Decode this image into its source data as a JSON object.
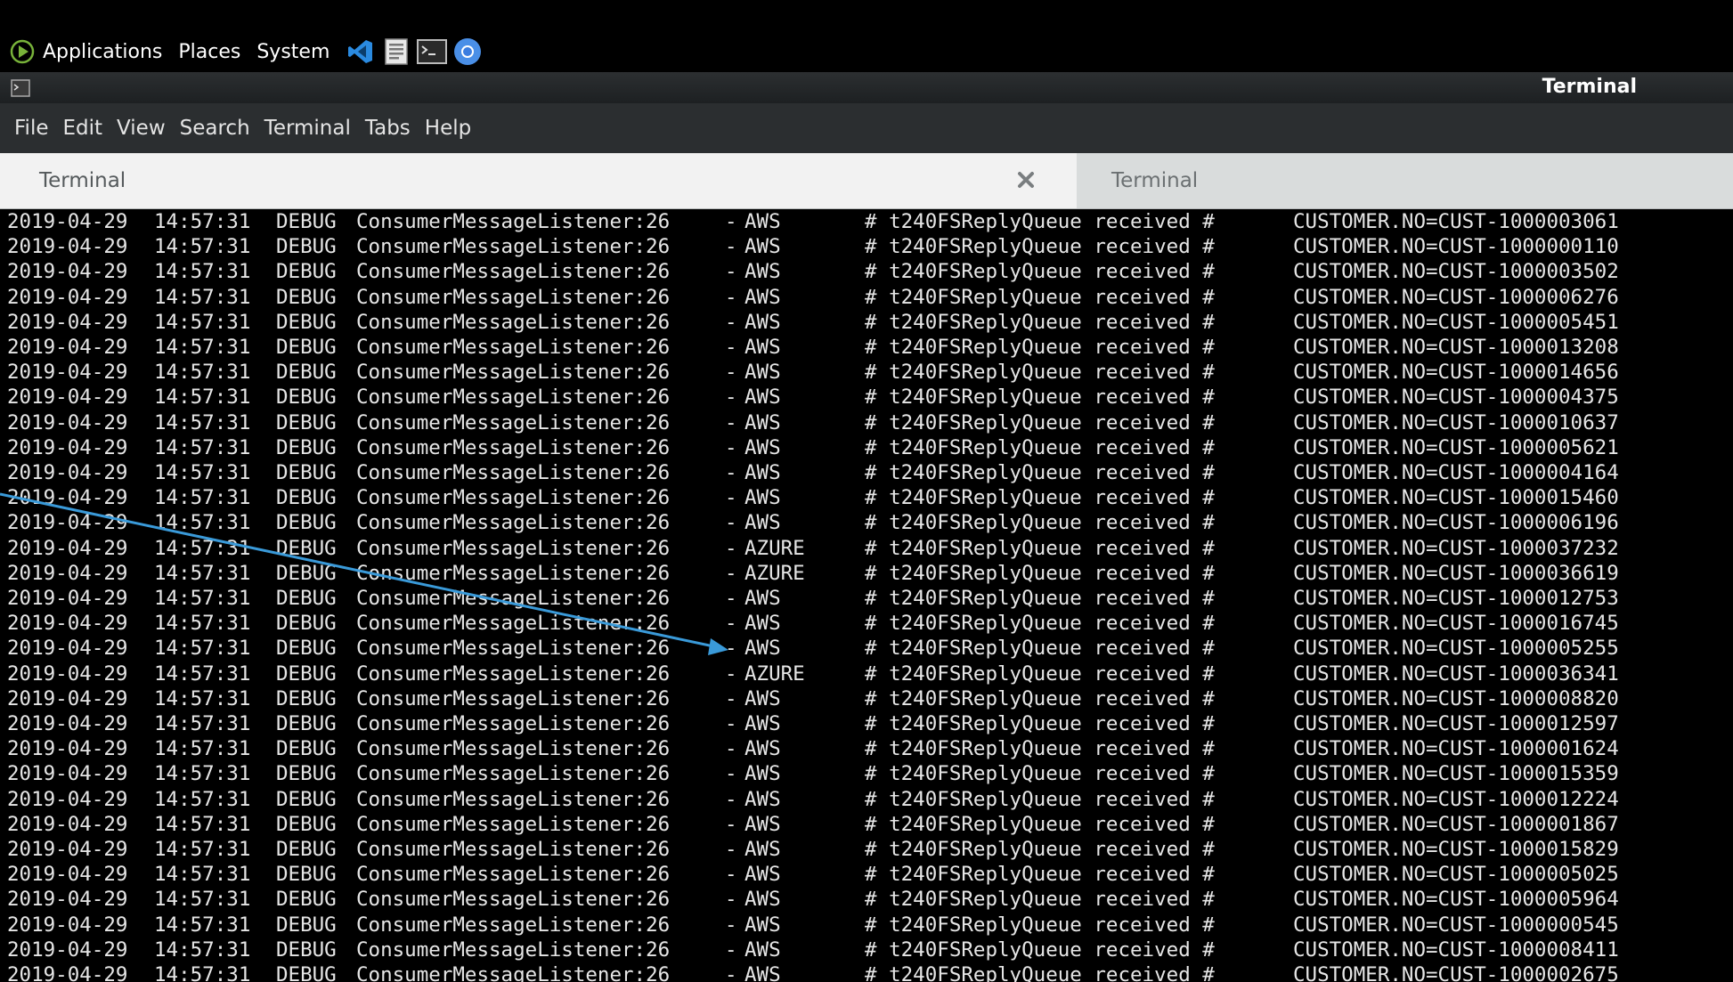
{
  "top_panel": {
    "menus": [
      "Applications",
      "Places",
      "System"
    ],
    "launchers": [
      {
        "name": "vscode-icon"
      },
      {
        "name": "text-editor-icon"
      },
      {
        "name": "terminal-launcher-icon"
      },
      {
        "name": "chromium-icon"
      }
    ]
  },
  "window": {
    "title": "Terminal"
  },
  "menubar": {
    "items": [
      "File",
      "Edit",
      "View",
      "Search",
      "Terminal",
      "Tabs",
      "Help"
    ]
  },
  "tabs": [
    {
      "label": "Terminal",
      "active": true
    },
    {
      "label": "Terminal",
      "active": false
    }
  ],
  "log": {
    "date": "2019-04-29",
    "time": "14:57:31",
    "level": "DEBUG",
    "source": "ConsumerMessageListener:26",
    "dash": "-",
    "message": "# t240FSReplyQueue received #",
    "lines": [
      {
        "cloud": "AWS",
        "customer": "CUSTOMER.NO=CUST-1000003061"
      },
      {
        "cloud": "AWS",
        "customer": "CUSTOMER.NO=CUST-1000000110"
      },
      {
        "cloud": "AWS",
        "customer": "CUSTOMER.NO=CUST-1000003502"
      },
      {
        "cloud": "AWS",
        "customer": "CUSTOMER.NO=CUST-1000006276"
      },
      {
        "cloud": "AWS",
        "customer": "CUSTOMER.NO=CUST-1000005451"
      },
      {
        "cloud": "AWS",
        "customer": "CUSTOMER.NO=CUST-1000013208"
      },
      {
        "cloud": "AWS",
        "customer": "CUSTOMER.NO=CUST-1000014656"
      },
      {
        "cloud": "AWS",
        "customer": "CUSTOMER.NO=CUST-1000004375"
      },
      {
        "cloud": "AWS",
        "customer": "CUSTOMER.NO=CUST-1000010637"
      },
      {
        "cloud": "AWS",
        "customer": "CUSTOMER.NO=CUST-1000005621"
      },
      {
        "cloud": "AWS",
        "customer": "CUSTOMER.NO=CUST-1000004164"
      },
      {
        "cloud": "AWS",
        "customer": "CUSTOMER.NO=CUST-1000015460"
      },
      {
        "cloud": "AWS",
        "customer": "CUSTOMER.NO=CUST-1000006196"
      },
      {
        "cloud": "AZURE",
        "customer": "CUSTOMER.NO=CUST-1000037232"
      },
      {
        "cloud": "AZURE",
        "customer": "CUSTOMER.NO=CUST-1000036619"
      },
      {
        "cloud": "AWS",
        "customer": "CUSTOMER.NO=CUST-1000012753"
      },
      {
        "cloud": "AWS",
        "customer": "CUSTOMER.NO=CUST-1000016745"
      },
      {
        "cloud": "AWS",
        "customer": "CUSTOMER.NO=CUST-1000005255"
      },
      {
        "cloud": "AZURE",
        "customer": "CUSTOMER.NO=CUST-1000036341"
      },
      {
        "cloud": "AWS",
        "customer": "CUSTOMER.NO=CUST-1000008820"
      },
      {
        "cloud": "AWS",
        "customer": "CUSTOMER.NO=CUST-1000012597"
      },
      {
        "cloud": "AWS",
        "customer": "CUSTOMER.NO=CUST-1000001624"
      },
      {
        "cloud": "AWS",
        "customer": "CUSTOMER.NO=CUST-1000015359"
      },
      {
        "cloud": "AWS",
        "customer": "CUSTOMER.NO=CUST-1000012224"
      },
      {
        "cloud": "AWS",
        "customer": "CUSTOMER.NO=CUST-1000001867"
      },
      {
        "cloud": "AWS",
        "customer": "CUSTOMER.NO=CUST-1000015829"
      },
      {
        "cloud": "AWS",
        "customer": "CUSTOMER.NO=CUST-1000005025"
      },
      {
        "cloud": "AWS",
        "customer": "CUSTOMER.NO=CUST-1000005964"
      },
      {
        "cloud": "AWS",
        "customer": "CUSTOMER.NO=CUST-1000000545"
      },
      {
        "cloud": "AWS",
        "customer": "CUSTOMER.NO=CUST-1000008411"
      },
      {
        "cloud": "AWS",
        "customer": "CUSTOMER.NO=CUST-1000002675"
      }
    ]
  },
  "colors": {
    "terminal_bg": "#000000",
    "terminal_fg": "#e6e6e6",
    "annotation_arrow": "#3a9ad9"
  }
}
